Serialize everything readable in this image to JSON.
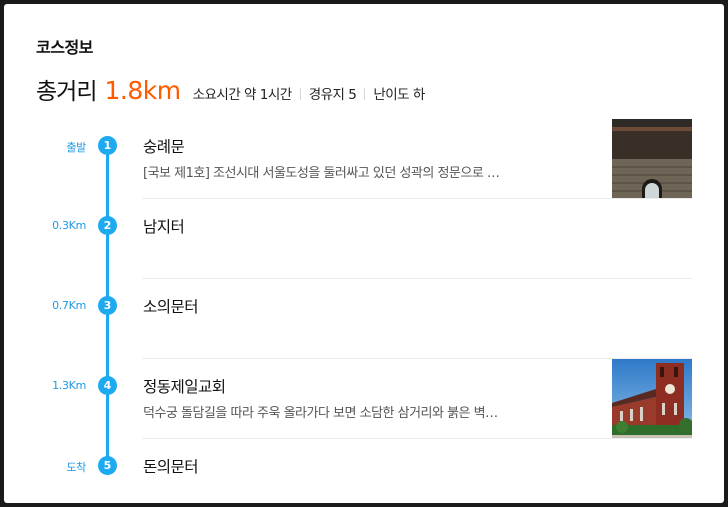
{
  "course": {
    "section_title": "코스정보",
    "total_label": "총거리",
    "total_distance": "1.8km",
    "duration": "소요시간 약 1시간",
    "waypoints": "경유지 5",
    "difficulty": "난이도 하"
  },
  "stops": [
    {
      "num": "1",
      "distance": "출발",
      "name": "숭례문",
      "desc": "[국보 제1호] 조선시대 서울도성을 둘러싸고 있던 성곽의 정문으로 …",
      "has_image": true
    },
    {
      "num": "2",
      "distance": "0.3Km",
      "name": "남지터",
      "desc": "",
      "has_image": false
    },
    {
      "num": "3",
      "distance": "0.7Km",
      "name": "소의문터",
      "desc": "",
      "has_image": false
    },
    {
      "num": "4",
      "distance": "1.3Km",
      "name": "정동제일교회",
      "desc": "덕수궁 돌담길을 따라 주욱 올라가다 보면 소담한 삼거리와 붉은 벽…",
      "has_image": true
    },
    {
      "num": "5",
      "distance": "도착",
      "name": "돈의문터",
      "desc": "",
      "has_image": false
    }
  ],
  "colors": {
    "accent_orange": "#ff5a00",
    "route_blue": "#1eaaf1"
  }
}
